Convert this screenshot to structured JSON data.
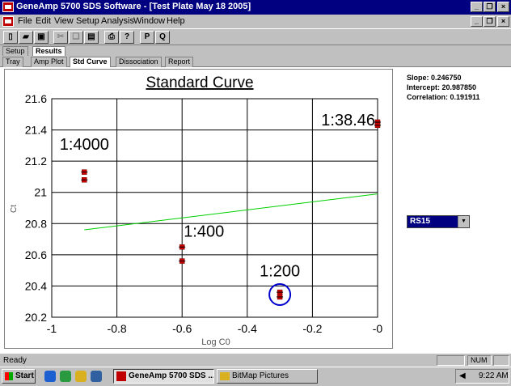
{
  "window": {
    "title": "GeneAmp 5700 SDS Software - [Test Plate May 18 2005]"
  },
  "menu": [
    "File",
    "Edit",
    "View",
    "Setup",
    "Analysis",
    "Window",
    "Help"
  ],
  "toolbar": {
    "p_label": "P",
    "q_label": "Q"
  },
  "top_tabs": [
    "Setup",
    "Results"
  ],
  "sub_tabs": [
    "Tray",
    "Amp Plot",
    "Std Curve",
    "Dissociation",
    "Report"
  ],
  "stats": {
    "slope": "Slope:  0.246750",
    "intercept": "Intercept:  20.987850",
    "correlation": "Correlation:  0.191911"
  },
  "dropdown": {
    "value": "RS15"
  },
  "status": {
    "ready": "Ready",
    "num": "NUM"
  },
  "taskbar": {
    "start": "Start",
    "items": [
      "GeneAmp 5700 SDS ...",
      "BitMap Pictures"
    ],
    "time": "9:22 AM"
  },
  "chart_data": {
    "type": "scatter",
    "title": "Standard Curve",
    "xlabel": "Log C0",
    "ylabel": "Ct",
    "xlim": [
      -1,
      0
    ],
    "ylim": [
      20.2,
      21.6
    ],
    "xticks": [
      "-1",
      "-0.8",
      "-0.6",
      "-0.4",
      "-0.2",
      "-0"
    ],
    "yticks": [
      "20.2",
      "20.4",
      "20.6",
      "20.8",
      "21",
      "21.2",
      "21.4",
      "21.6"
    ],
    "grid": true,
    "points": [
      {
        "x": -0.9,
        "y": 21.13
      },
      {
        "x": -0.9,
        "y": 21.08
      },
      {
        "x": -0.6,
        "y": 20.65
      },
      {
        "x": -0.6,
        "y": 20.56
      },
      {
        "x": -0.3,
        "y": 20.36
      },
      {
        "x": -0.3,
        "y": 20.33
      },
      {
        "x": 0.0,
        "y": 21.45
      },
      {
        "x": 0.0,
        "y": 21.43
      }
    ],
    "fit_line": {
      "x": [
        -0.9,
        0.0
      ],
      "y": [
        20.76,
        20.99
      ],
      "color": "#00d000"
    },
    "annotations": [
      {
        "text": "1:4000",
        "x": -0.9,
        "y": 21.2
      },
      {
        "text": "1:400",
        "x": -0.6,
        "y": 20.68
      },
      {
        "text": "1:200",
        "x": -0.3,
        "y": 20.39
      },
      {
        "text": "1:38.46",
        "x": 0.0,
        "y": 21.45
      }
    ],
    "highlight": {
      "x": -0.3,
      "y": 20.345,
      "color": "#0000cc"
    },
    "point_color": "#cc0000"
  }
}
